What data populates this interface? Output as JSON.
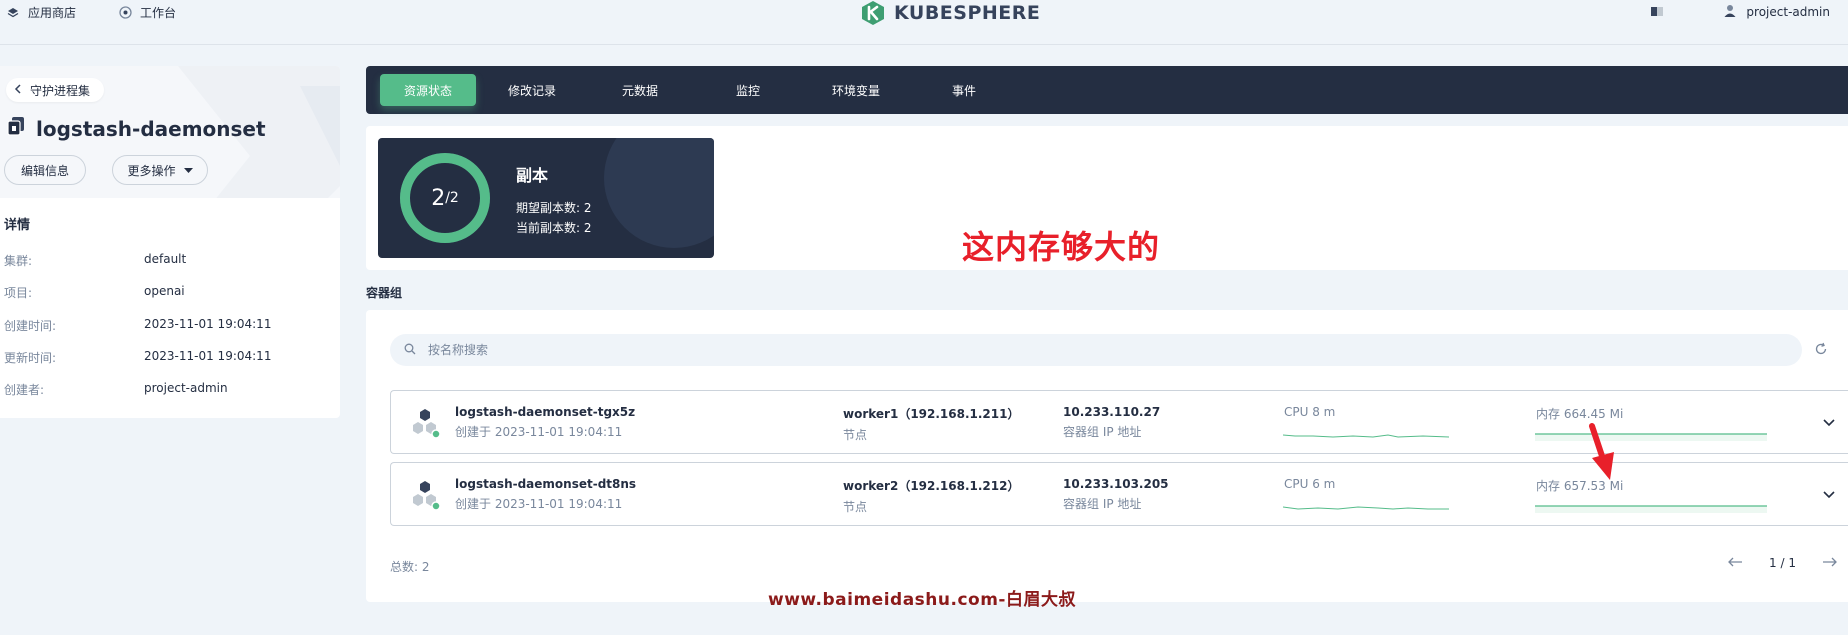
{
  "topnav": {
    "app_store": "应用商店",
    "workbench": "工作台",
    "logo": "KUBESPHERE",
    "user": "project-admin"
  },
  "left": {
    "back_label": "守护进程集",
    "title": "logstash-daemonset",
    "edit_button": "编辑信息",
    "more_button": "更多操作",
    "details_title": "详情",
    "details": [
      {
        "key": "集群:",
        "value": "default"
      },
      {
        "key": "项目:",
        "value": "openai"
      },
      {
        "key": "创建时间:",
        "value": "2023-11-01 19:04:11"
      },
      {
        "key": "更新时间:",
        "value": "2023-11-01 19:04:11"
      },
      {
        "key": "创建者:",
        "value": "project-admin"
      }
    ]
  },
  "tabs": [
    "资源状态",
    "修改记录",
    "元数据",
    "监控",
    "环境变量",
    "事件"
  ],
  "active_tab": "资源状态",
  "replica": {
    "ready": "2",
    "total": "/2",
    "ready_fraction": 1.0,
    "title": "副本",
    "desired": "期望副本数: 2",
    "current": "当前副本数: 2"
  },
  "annotation": "这内存够大的",
  "pods_section_label": "容器组",
  "search": {
    "placeholder": "按名称搜索"
  },
  "pods": [
    {
      "name": "logstash-daemonset-tgx5z",
      "created": "创建于 2023-11-01 19:04:11",
      "node": "worker1（192.168.1.211）",
      "node_label": "节点",
      "ip": "10.233.110.27",
      "ip_label": "容器组 IP 地址",
      "cpu": "CPU 8 m",
      "memory": "内存 664.45 Mi",
      "status_color": "#55bc8a"
    },
    {
      "name": "logstash-daemonset-dt8ns",
      "created": "创建于 2023-11-01 19:04:11",
      "node": "worker2（192.168.1.212）",
      "node_label": "节点",
      "ip": "10.233.103.205",
      "ip_label": "容器组 IP 地址",
      "cpu": "CPU 6 m",
      "memory": "内存 657.53 Mi",
      "status_color": "#55bc8a"
    }
  ],
  "total": "总数: 2",
  "pager": "1 / 1",
  "site_mark": "www.baimeidashu.com-白眉大叔",
  "colors": {
    "accent": "#55bc8a",
    "dark": "#242e42",
    "annotation": "#e8202a"
  }
}
